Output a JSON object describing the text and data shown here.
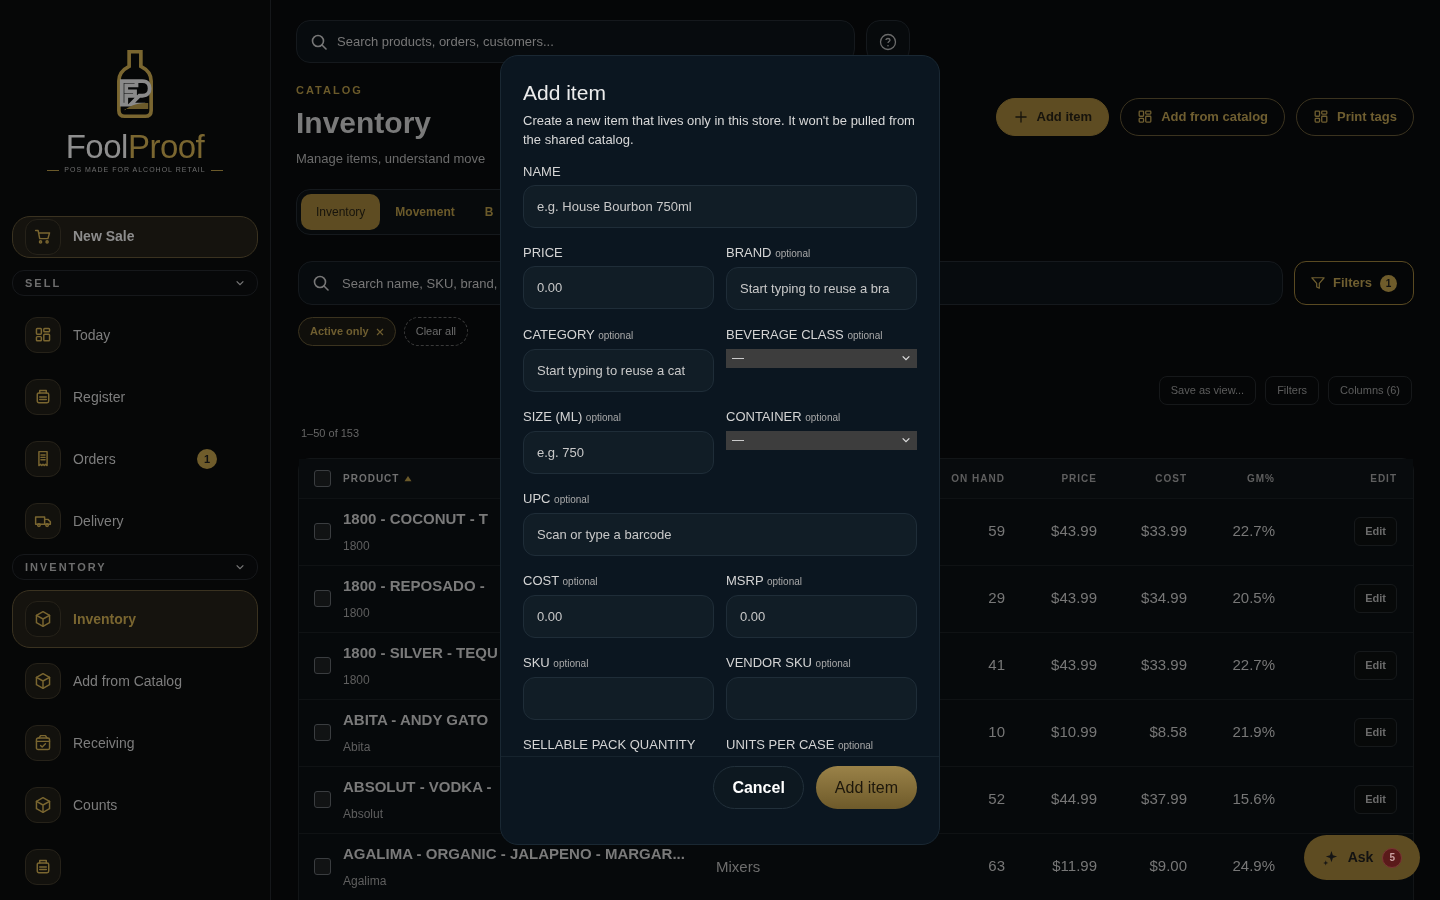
{
  "sidebar": {
    "logo": {
      "parts": [
        "Fool",
        "Proof"
      ],
      "tagline": "POS MADE FOR ALCOHOL RETAIL"
    },
    "new_sale": {
      "label": "New Sale"
    },
    "sections": [
      {
        "title": "SELL",
        "expanded": true,
        "items": [
          {
            "label": "Today",
            "kind": "grid",
            "selected": false
          },
          {
            "label": "Register",
            "kind": "register",
            "selected": false
          },
          {
            "label": "Orders",
            "kind": "receipt",
            "selected": false,
            "badge": "1"
          },
          {
            "label": "Delivery",
            "kind": "truck",
            "selected": false
          }
        ]
      },
      {
        "title": "INVENTORY",
        "expanded": true,
        "items": [
          {
            "label": "Inventory",
            "kind": "box",
            "selected": true
          },
          {
            "label": "Add from Catalog",
            "kind": "box",
            "selected": false
          },
          {
            "label": "Receiving",
            "kind": "checkbox",
            "selected": false
          },
          {
            "label": "Counts",
            "kind": "box",
            "selected": false
          },
          {
            "kind": "register",
            "selected": false
          }
        ]
      }
    ]
  },
  "search": {
    "placeholder": "Search products, orders, customers..."
  },
  "header": {
    "eyebrow": "CATALOG",
    "title": "Inventory",
    "subtitle": "Manage items, understand move"
  },
  "actions": [
    {
      "label": "Add item",
      "kind": "primary"
    },
    {
      "label": "Add from catalog",
      "kind": "outline"
    },
    {
      "label": "Print tags",
      "kind": "outline"
    }
  ],
  "tabs": [
    {
      "label": "Inventory",
      "selected": true
    },
    {
      "label": "Movement",
      "selected": false
    },
    {
      "label": "B",
      "selected": false
    }
  ],
  "filter_search": {
    "placeholder": "Search name, SKU, brand,"
  },
  "filters_button": {
    "label": "Filters",
    "count": "1"
  },
  "chips": [
    {
      "label": "Active only",
      "kind": "active",
      "removable": true
    },
    {
      "label": "Clear all",
      "kind": "clear",
      "removable": false
    }
  ],
  "view_buttons": [
    "Save as view...",
    "Filters",
    "Columns (6)"
  ],
  "range": "1–50 of 153",
  "table": {
    "all_checked": false,
    "columns": [
      {
        "label": "PRODUCT",
        "sorted": true
      },
      {
        "label": "ON HAND",
        "sorted": false
      },
      {
        "label": "PRICE",
        "sorted": false
      },
      {
        "label": "COST",
        "sorted": false
      },
      {
        "label": "GM%",
        "sorted": false
      },
      {
        "label": "EDIT",
        "sorted": false
      }
    ],
    "rows": [
      {
        "checked": false,
        "product": "1800 - COCONUT - T",
        "brand": "1800",
        "on_hand": "59",
        "price": "$43.99",
        "cost": "$33.99",
        "gm": "22.7%",
        "edit": "Edit"
      },
      {
        "checked": false,
        "product": "1800 - REPOSADO -",
        "brand": "1800",
        "on_hand": "29",
        "price": "$43.99",
        "cost": "$34.99",
        "gm": "20.5%",
        "edit": "Edit"
      },
      {
        "checked": false,
        "product": "1800 - SILVER - TEQU",
        "brand": "1800",
        "on_hand": "41",
        "price": "$43.99",
        "cost": "$33.99",
        "gm": "22.7%",
        "edit": "Edit"
      },
      {
        "checked": false,
        "product": "ABITA - ANDY GATO",
        "brand": "Abita",
        "on_hand": "10",
        "price": "$10.99",
        "cost": "$8.58",
        "gm": "21.9%",
        "edit": "Edit"
      },
      {
        "checked": false,
        "product": "ABSOLUT - VODKA -",
        "brand": "Absolut",
        "on_hand": "52",
        "price": "$44.99",
        "cost": "$37.99",
        "gm": "15.6%",
        "edit": "Edit"
      },
      {
        "checked": false,
        "product": "AGALIMA - ORGANIC - JALAPENO - MARGAR...",
        "brand": "Agalima",
        "category": "Mixers",
        "on_hand": "63",
        "price": "$11.99",
        "cost": "$9.00",
        "gm": "24.9%"
      }
    ]
  },
  "ask": {
    "label": "Ask",
    "count": "5"
  },
  "modal": {
    "title": "Add item",
    "description": "Create a new item that lives only in this store. It won't be pulled from the shared catalog.",
    "field_rows": [
      [
        {
          "label": "NAME",
          "kind": "input",
          "placeholder": "e.g. House Bourbon 750ml"
        }
      ],
      [
        {
          "label": "PRICE",
          "kind": "input",
          "placeholder": "0.00"
        },
        {
          "label": "BRAND",
          "hint": "optional",
          "kind": "input",
          "placeholder": "Start typing to reuse a bra"
        }
      ],
      [
        {
          "label": "CATEGORY",
          "hint": "optional",
          "kind": "input",
          "placeholder": "Start typing to reuse a cat"
        },
        {
          "label": "BEVERAGE CLASS",
          "hint": "optional",
          "kind": "select",
          "value": "—"
        }
      ],
      [
        {
          "label": "SIZE (ML)",
          "hint": "optional",
          "kind": "input",
          "placeholder": "e.g. 750"
        },
        {
          "label": "CONTAINER",
          "hint": "optional",
          "kind": "select",
          "value": "—"
        }
      ],
      [
        {
          "label": "UPC",
          "hint": "optional",
          "kind": "input",
          "placeholder": "Scan or type a barcode"
        }
      ],
      [
        {
          "label": "COST",
          "hint": "optional",
          "kind": "input",
          "placeholder": "0.00"
        },
        {
          "label": "MSRP",
          "hint": "optional",
          "kind": "input",
          "placeholder": "0.00"
        }
      ],
      [
        {
          "label": "SKU",
          "hint": "optional",
          "kind": "input"
        },
        {
          "label": "VENDOR SKU",
          "hint": "optional",
          "kind": "input"
        }
      ],
      [
        {
          "label": "SELLABLE PACK QUANTITY",
          "kind": "label"
        },
        {
          "label": "UNITS PER CASE",
          "hint": "optional",
          "kind": "label"
        }
      ]
    ],
    "buttons": [
      {
        "label": "Cancel",
        "kind": "secondary"
      },
      {
        "label": "Add item",
        "kind": "primary"
      }
    ]
  }
}
